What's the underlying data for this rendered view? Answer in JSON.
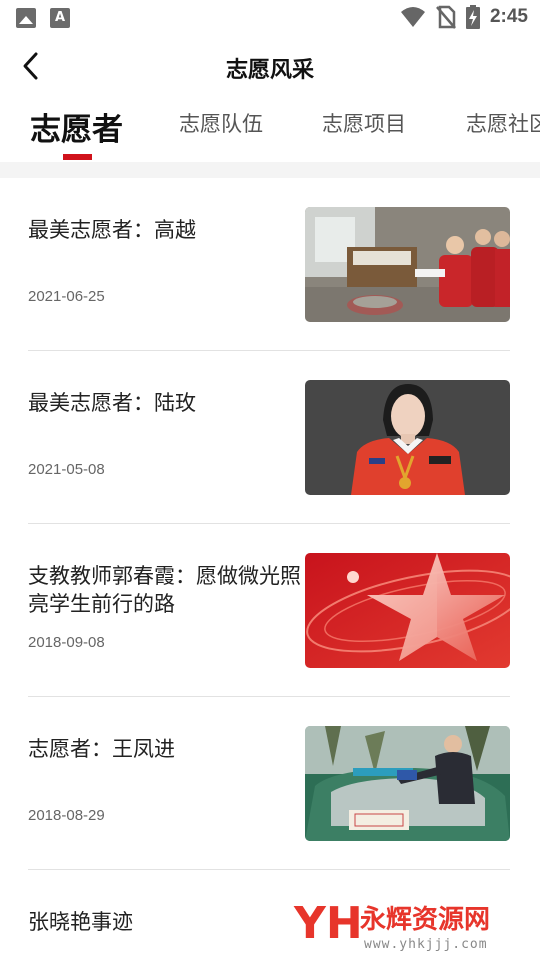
{
  "status_bar": {
    "time": "2:45"
  },
  "header": {
    "title": "志愿风采"
  },
  "tabs": [
    {
      "label": "志愿者",
      "active": true
    },
    {
      "label": "志愿队伍",
      "active": false
    },
    {
      "label": "志愿项目",
      "active": false
    },
    {
      "label": "志愿社区",
      "active": false
    }
  ],
  "news": [
    {
      "title": "最美志愿者：高越",
      "date": "2021-06-25",
      "thumb": "volunteers-photo"
    },
    {
      "title": "最美志愿者：陆玫",
      "date": "2021-05-08",
      "thumb": "portrait-photo"
    },
    {
      "title": "支教教师郭春霞：愿做微光照亮学生前行的路",
      "date": "2018-09-08",
      "thumb": "red-star-graphic"
    },
    {
      "title": "志愿者：王凤进",
      "date": "2018-08-29",
      "thumb": "taxi-photo"
    },
    {
      "title": "张晓艳事迹"
    }
  ],
  "watermark": {
    "brand": "永辉资源网",
    "url": "www.yhkjjj.com"
  },
  "colors": {
    "accent": "#d0121b",
    "text": "#222222",
    "date": "#666666"
  }
}
